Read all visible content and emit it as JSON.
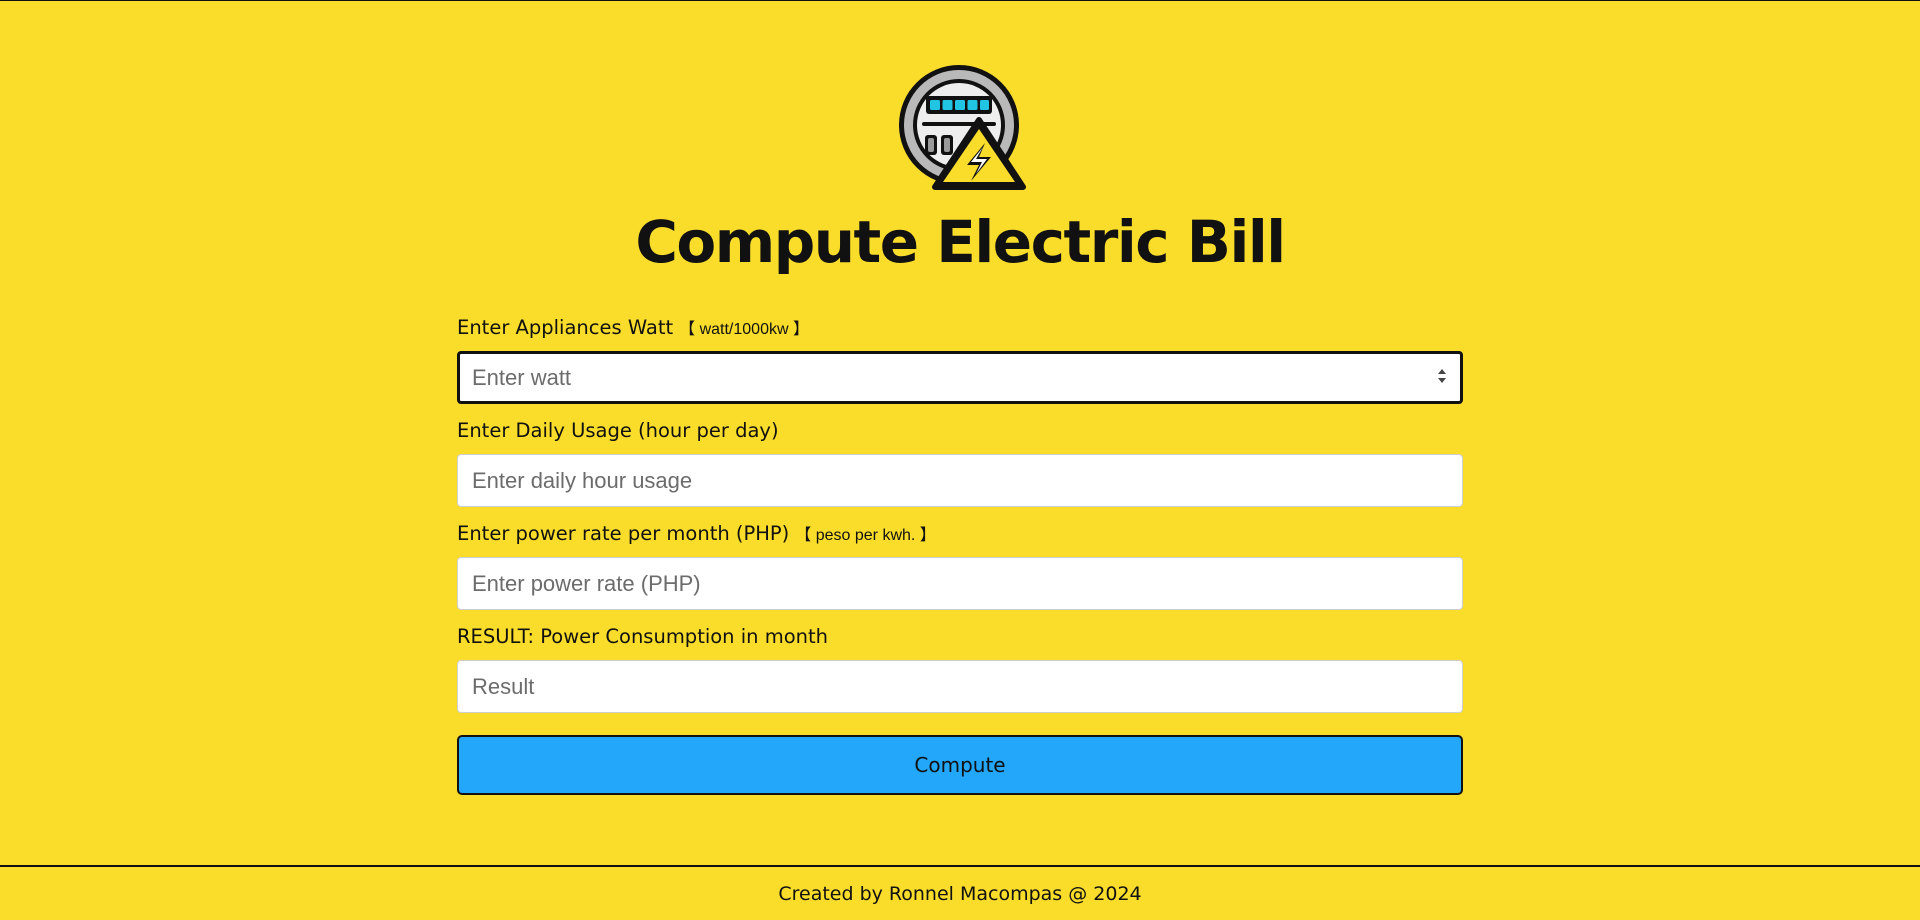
{
  "header": {
    "title": "Compute Electric Bill",
    "logo_icon": "electric-meter-warning-icon"
  },
  "form": {
    "watt": {
      "label": "Enter Appliances Watt",
      "hint": "【 watt/1000kw 】",
      "placeholder": "Enter watt",
      "value": ""
    },
    "daily_usage": {
      "label": "Enter Daily Usage (hour per day)",
      "placeholder": "Enter daily hour usage",
      "value": ""
    },
    "power_rate": {
      "label": "Enter power rate per month (PHP)",
      "hint": "【 peso per kwh. 】",
      "placeholder": "Enter power rate (PHP)",
      "value": ""
    },
    "result": {
      "label": "RESULT: Power Consumption in month",
      "placeholder": "Result",
      "value": ""
    },
    "compute_label": "Compute"
  },
  "footer": {
    "text": "Created by Ronnel Macompas @ 2024"
  },
  "colors": {
    "background": "#FADD2B",
    "button": "#22A7FB",
    "text": "#111111"
  }
}
